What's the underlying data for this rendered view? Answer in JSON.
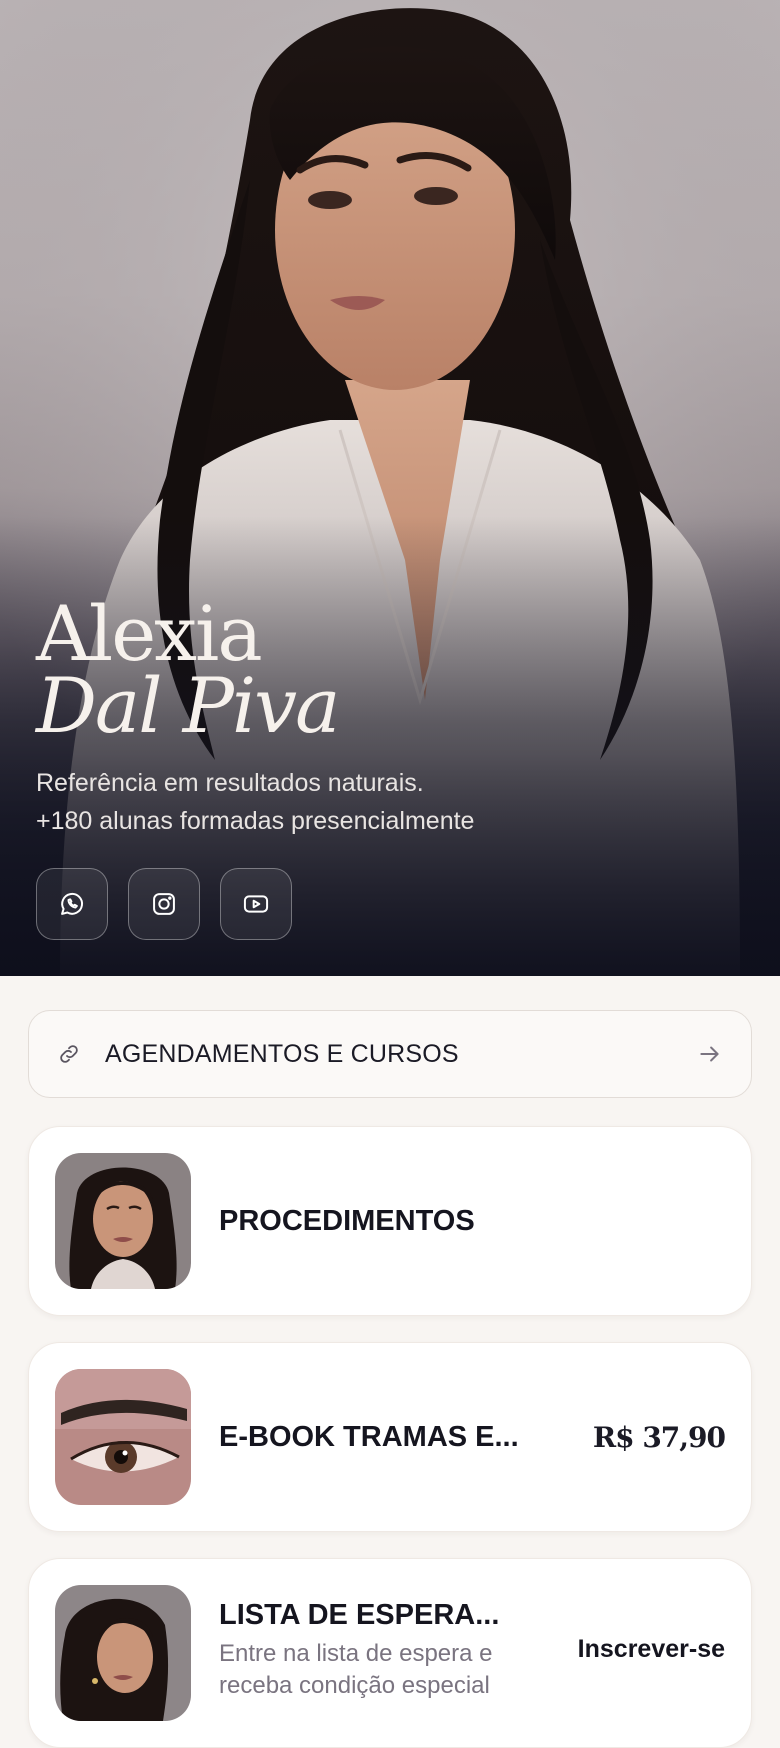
{
  "hero": {
    "first_name": "Alexia",
    "last_name": "Dal Piva",
    "tagline_line1": "Referência em resultados naturais.",
    "tagline_line2": "+180 alunas formadas presencialmente",
    "social": [
      {
        "name": "whatsapp-icon"
      },
      {
        "name": "instagram-icon"
      },
      {
        "name": "youtube-icon"
      }
    ]
  },
  "link_bar": {
    "icon": "link-icon",
    "label": "AGENDAMENTOS E CURSOS",
    "trailing_icon": "arrow-right-icon"
  },
  "cards": [
    {
      "title": "PROCEDIMENTOS",
      "thumb": "portrait-thumbnail"
    },
    {
      "title": "E-BOOK TRAMAS E...",
      "price": "R$ 37,90",
      "thumb": "eye-brow-thumbnail"
    },
    {
      "title": "LISTA DE ESPERA...",
      "subtitle": "Entre na lista de espera e receba condição especial",
      "cta": "Inscrever-se",
      "thumb": "portrait-thumbnail"
    }
  ],
  "colors": {
    "background": "#f8f5f2",
    "hero_dark": "#12131f",
    "text_dark": "#15151f",
    "muted": "#7a7480"
  }
}
